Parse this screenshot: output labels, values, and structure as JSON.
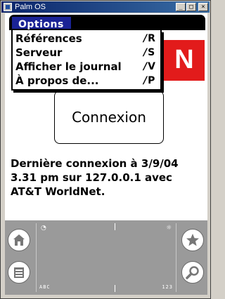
{
  "window": {
    "title": "Palm OS",
    "minimize_symbol": "_",
    "maximize_symbol": "□",
    "close_symbol": "×"
  },
  "menubar": {
    "active_menu": "Options"
  },
  "menu": {
    "items": [
      {
        "label": "Références",
        "shortcut": "R"
      },
      {
        "label": "Serveur",
        "shortcut": "S"
      },
      {
        "label": "Afficher le journal",
        "shortcut": "V"
      },
      {
        "label": "À propos de...",
        "shortcut": "P"
      }
    ],
    "shortcut_prefix": "/"
  },
  "logo": {
    "letter": "N",
    "color": "#e21b1b"
  },
  "connect_button": {
    "label": "Connexion"
  },
  "status": {
    "text": "Dernière connexion à 3/9/04\n3.31 pm sur 127.0.0.1 avec\nAT&T WorldNet."
  },
  "graffiti": {
    "abc_label": "ABC",
    "numbers_label": "123",
    "buttons": [
      "home-icon",
      "menu-icon",
      "star-icon",
      "search-icon"
    ],
    "clock_symbol": "◔",
    "brightness_symbol": "☼"
  },
  "colors": {
    "menu_highlight": "#1a2396",
    "title_bar": "#0a246a",
    "graffiti_bg": "#9a9a9a"
  }
}
